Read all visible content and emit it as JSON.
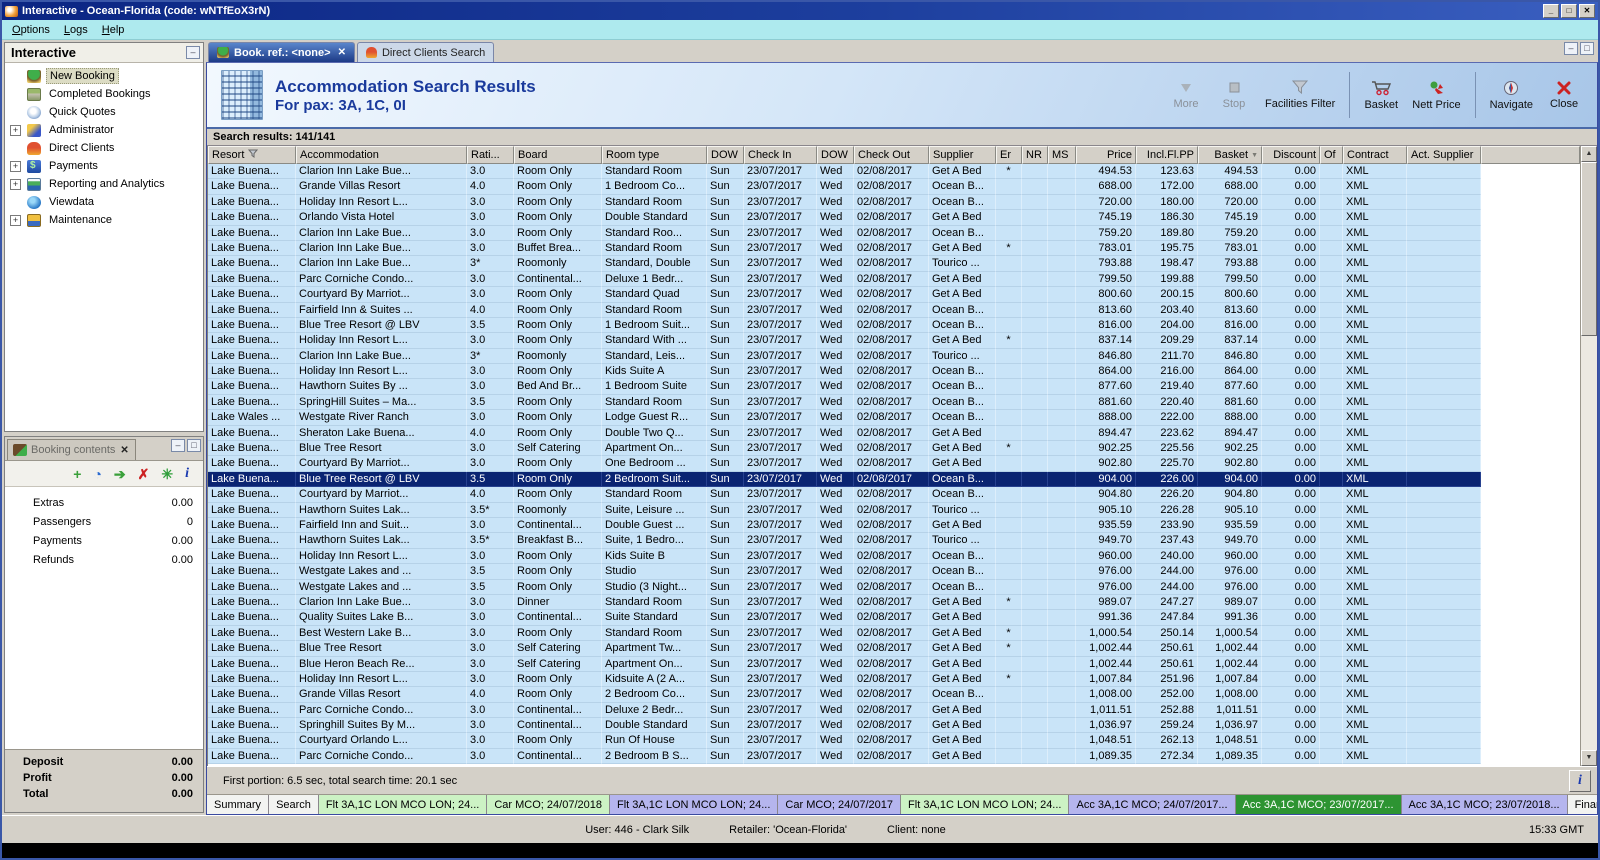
{
  "window": {
    "title": "Interactive - Ocean-Florida (code: wNTfEoX3rN)"
  },
  "menu": {
    "items": [
      "Options",
      "Logs",
      "Help"
    ]
  },
  "sidebar": {
    "title": "Interactive",
    "items": [
      {
        "label": "New Booking",
        "icon": "palm",
        "expandable": false,
        "selected": true
      },
      {
        "label": "Completed Bookings",
        "icon": "money",
        "expandable": false
      },
      {
        "label": "Quick Quotes",
        "icon": "clock",
        "expandable": false
      },
      {
        "label": "Administrator",
        "icon": "admin",
        "expandable": true
      },
      {
        "label": "Direct Clients",
        "icon": "person",
        "expandable": false
      },
      {
        "label": "Payments",
        "icon": "payments",
        "expandable": true
      },
      {
        "label": "Reporting and Analytics",
        "icon": "report",
        "expandable": true
      },
      {
        "label": "Viewdata",
        "icon": "globe",
        "expandable": false
      },
      {
        "label": "Maintenance",
        "icon": "toolbox",
        "expandable": true
      }
    ]
  },
  "booking_panel": {
    "title": "Booking contents",
    "toolbar_icons": [
      "add",
      "schedule",
      "basket-move",
      "delete",
      "holiday",
      "info"
    ],
    "items": [
      {
        "label": "Extras",
        "value": "0.00"
      },
      {
        "label": "Passengers",
        "value": "0"
      },
      {
        "label": "Payments",
        "value": "0.00"
      },
      {
        "label": "Refunds",
        "value": "0.00"
      }
    ],
    "totals": [
      {
        "label": "Deposit",
        "value": "0.00"
      },
      {
        "label": "Profit",
        "value": "0.00"
      },
      {
        "label": "Total",
        "value": "0.00"
      }
    ]
  },
  "doc_tabs": [
    {
      "label": "Book. ref.: <none>",
      "icon": "palm",
      "closable": true,
      "active": true
    },
    {
      "label": "Direct Clients Search",
      "icon": "person",
      "closable": false,
      "active": false
    }
  ],
  "header": {
    "title": "Accommodation Search Results",
    "subtitle": "For pax: 3A, 1C, 0I"
  },
  "toolbar": {
    "buttons": [
      {
        "label": "More",
        "icon": "more",
        "disabled": true
      },
      {
        "label": "Stop",
        "icon": "stop",
        "disabled": true
      },
      {
        "label": "Facilities Filter",
        "icon": "funnel",
        "disabled": false
      },
      {
        "sep": true
      },
      {
        "label": "Basket",
        "icon": "basket",
        "disabled": false
      },
      {
        "label": "Nett Price",
        "icon": "nett-price",
        "disabled": false
      },
      {
        "sep": true
      },
      {
        "label": "Navigate",
        "icon": "compass",
        "disabled": false
      },
      {
        "label": "Close",
        "icon": "close",
        "disabled": false
      }
    ]
  },
  "results": {
    "label": "Search results: 141/141"
  },
  "results_table": {
    "columns": [
      "Resort",
      "Accommodation",
      "Rati...",
      "Board",
      "Room type",
      "DOW",
      "Check In",
      "DOW",
      "Check Out",
      "Supplier",
      "Er",
      "NR",
      "MS",
      "Price",
      "Incl.Fl.PP",
      "Basket",
      "Discount",
      "Of",
      "Contract",
      "Act. Supplier"
    ],
    "row_defaults": {
      "dow_in": "Sun",
      "check_in": "23/07/2017",
      "dow_out": "Wed",
      "check_out": "02/08/2017",
      "discount": "0.00",
      "contract": "XML"
    },
    "selected_index": 20,
    "rows": [
      {
        "resort": "Lake Buena...",
        "accommodation": "Clarion Inn Lake Bue...",
        "rating": "3.0",
        "board": "Room Only",
        "room_type": "Standard Room",
        "supplier": "Get A Bed",
        "er": "*",
        "price": "494.53",
        "incl_fl_pp": "123.63",
        "basket": "494.53"
      },
      {
        "resort": "Lake Buena...",
        "accommodation": "Grande Villas Resort",
        "rating": "4.0",
        "board": "Room Only",
        "room_type": "1 Bedroom Co...",
        "supplier": "Ocean B...",
        "er": "",
        "price": "688.00",
        "incl_fl_pp": "172.00",
        "basket": "688.00"
      },
      {
        "resort": "Lake Buena...",
        "accommodation": "Holiday Inn Resort L...",
        "rating": "3.0",
        "board": "Room Only",
        "room_type": "Standard Room",
        "supplier": "Ocean B...",
        "er": "",
        "price": "720.00",
        "incl_fl_pp": "180.00",
        "basket": "720.00"
      },
      {
        "resort": "Lake Buena...",
        "accommodation": "Orlando Vista Hotel",
        "rating": "3.0",
        "board": "Room Only",
        "room_type": "Double Standard",
        "supplier": "Get A Bed",
        "er": "",
        "price": "745.19",
        "incl_fl_pp": "186.30",
        "basket": "745.19"
      },
      {
        "resort": "Lake Buena...",
        "accommodation": "Clarion Inn Lake Bue...",
        "rating": "3.0",
        "board": "Room Only",
        "room_type": "Standard Roo...",
        "supplier": "Ocean B...",
        "er": "",
        "price": "759.20",
        "incl_fl_pp": "189.80",
        "basket": "759.20"
      },
      {
        "resort": "Lake Buena...",
        "accommodation": "Clarion Inn Lake Bue...",
        "rating": "3.0",
        "board": "Buffet Brea...",
        "room_type": "Standard Room",
        "supplier": "Get A Bed",
        "er": "*",
        "price": "783.01",
        "incl_fl_pp": "195.75",
        "basket": "783.01"
      },
      {
        "resort": "Lake Buena...",
        "accommodation": "Clarion Inn Lake Bue...",
        "rating": "3*",
        "board": "Roomonly",
        "room_type": "Standard, Double",
        "supplier": "Tourico ...",
        "er": "",
        "price": "793.88",
        "incl_fl_pp": "198.47",
        "basket": "793.88"
      },
      {
        "resort": "Lake Buena...",
        "accommodation": "Parc Corniche Condo...",
        "rating": "3.0",
        "board": "Continental...",
        "room_type": "Deluxe 1 Bedr...",
        "supplier": "Get A Bed",
        "er": "",
        "price": "799.50",
        "incl_fl_pp": "199.88",
        "basket": "799.50"
      },
      {
        "resort": "Lake Buena...",
        "accommodation": "Courtyard By Marriot...",
        "rating": "3.0",
        "board": "Room Only",
        "room_type": "Standard Quad",
        "supplier": "Get A Bed",
        "er": "",
        "price": "800.60",
        "incl_fl_pp": "200.15",
        "basket": "800.60"
      },
      {
        "resort": "Lake Buena...",
        "accommodation": "Fairfield Inn & Suites ...",
        "rating": "4.0",
        "board": "Room Only",
        "room_type": "Standard Room",
        "supplier": "Ocean B...",
        "er": "",
        "price": "813.60",
        "incl_fl_pp": "203.40",
        "basket": "813.60"
      },
      {
        "resort": "Lake Buena...",
        "accommodation": "Blue Tree Resort @ LBV",
        "rating": "3.5",
        "board": "Room Only",
        "room_type": "1 Bedroom Suit...",
        "supplier": "Ocean B...",
        "er": "",
        "price": "816.00",
        "incl_fl_pp": "204.00",
        "basket": "816.00"
      },
      {
        "resort": "Lake Buena...",
        "accommodation": "Holiday Inn Resort L...",
        "rating": "3.0",
        "board": "Room Only",
        "room_type": "Standard With ...",
        "supplier": "Get A Bed",
        "er": "*",
        "price": "837.14",
        "incl_fl_pp": "209.29",
        "basket": "837.14"
      },
      {
        "resort": "Lake Buena...",
        "accommodation": "Clarion Inn Lake Bue...",
        "rating": "3*",
        "board": "Roomonly",
        "room_type": "Standard, Leis...",
        "supplier": "Tourico ...",
        "er": "",
        "price": "846.80",
        "incl_fl_pp": "211.70",
        "basket": "846.80"
      },
      {
        "resort": "Lake Buena...",
        "accommodation": "Holiday Inn Resort L...",
        "rating": "3.0",
        "board": "Room Only",
        "room_type": "Kids Suite A",
        "supplier": "Ocean B...",
        "er": "",
        "price": "864.00",
        "incl_fl_pp": "216.00",
        "basket": "864.00"
      },
      {
        "resort": "Lake Buena...",
        "accommodation": "Hawthorn Suites By ...",
        "rating": "3.0",
        "board": "Bed And Br...",
        "room_type": "1 Bedroom Suite",
        "supplier": "Ocean B...",
        "er": "",
        "price": "877.60",
        "incl_fl_pp": "219.40",
        "basket": "877.60"
      },
      {
        "resort": "Lake Buena...",
        "accommodation": "SpringHill Suites – Ma...",
        "rating": "3.5",
        "board": "Room Only",
        "room_type": "Standard Room",
        "supplier": "Ocean B...",
        "er": "",
        "price": "881.60",
        "incl_fl_pp": "220.40",
        "basket": "881.60"
      },
      {
        "resort": "Lake Wales ...",
        "accommodation": "Westgate River Ranch",
        "rating": "3.0",
        "board": "Room Only",
        "room_type": "Lodge Guest R...",
        "supplier": "Ocean B...",
        "er": "",
        "price": "888.00",
        "incl_fl_pp": "222.00",
        "basket": "888.00"
      },
      {
        "resort": "Lake Buena...",
        "accommodation": "Sheraton Lake Buena...",
        "rating": "4.0",
        "board": "Room Only",
        "room_type": "Double Two Q...",
        "supplier": "Get A Bed",
        "er": "",
        "price": "894.47",
        "incl_fl_pp": "223.62",
        "basket": "894.47"
      },
      {
        "resort": "Lake Buena...",
        "accommodation": "Blue Tree Resort",
        "rating": "3.0",
        "board": "Self Catering",
        "room_type": "Apartment On...",
        "supplier": "Get A Bed",
        "er": "*",
        "price": "902.25",
        "incl_fl_pp": "225.56",
        "basket": "902.25"
      },
      {
        "resort": "Lake Buena...",
        "accommodation": "Courtyard By Marriot...",
        "rating": "3.0",
        "board": "Room Only",
        "room_type": "One Bedroom ...",
        "supplier": "Get A Bed",
        "er": "",
        "price": "902.80",
        "incl_fl_pp": "225.70",
        "basket": "902.80"
      },
      {
        "resort": "Lake Buena...",
        "accommodation": "Blue Tree Resort @ LBV",
        "rating": "3.5",
        "board": "Room Only",
        "room_type": "2 Bedroom Suit...",
        "supplier": "Ocean B...",
        "er": "",
        "price": "904.00",
        "incl_fl_pp": "226.00",
        "basket": "904.00"
      },
      {
        "resort": "Lake Buena...",
        "accommodation": "Courtyard by Marriot...",
        "rating": "4.0",
        "board": "Room Only",
        "room_type": "Standard Room",
        "supplier": "Ocean B...",
        "er": "",
        "price": "904.80",
        "incl_fl_pp": "226.20",
        "basket": "904.80"
      },
      {
        "resort": "Lake Buena...",
        "accommodation": "Hawthorn Suites Lak...",
        "rating": "3.5*",
        "board": "Roomonly",
        "room_type": "Suite, Leisure ...",
        "supplier": "Tourico ...",
        "er": "",
        "price": "905.10",
        "incl_fl_pp": "226.28",
        "basket": "905.10"
      },
      {
        "resort": "Lake Buena...",
        "accommodation": "Fairfield Inn and Suit...",
        "rating": "3.0",
        "board": "Continental...",
        "room_type": "Double Guest ...",
        "supplier": "Get A Bed",
        "er": "",
        "price": "935.59",
        "incl_fl_pp": "233.90",
        "basket": "935.59"
      },
      {
        "resort": "Lake Buena...",
        "accommodation": "Hawthorn Suites Lak...",
        "rating": "3.5*",
        "board": "Breakfast B...",
        "room_type": "Suite, 1 Bedro...",
        "supplier": "Tourico ...",
        "er": "",
        "price": "949.70",
        "incl_fl_pp": "237.43",
        "basket": "949.70"
      },
      {
        "resort": "Lake Buena...",
        "accommodation": "Holiday Inn Resort L...",
        "rating": "3.0",
        "board": "Room Only",
        "room_type": "Kids Suite B",
        "supplier": "Ocean B...",
        "er": "",
        "price": "960.00",
        "incl_fl_pp": "240.00",
        "basket": "960.00"
      },
      {
        "resort": "Lake Buena...",
        "accommodation": "Westgate Lakes and ...",
        "rating": "3.5",
        "board": "Room Only",
        "room_type": "Studio",
        "supplier": "Ocean B...",
        "er": "",
        "price": "976.00",
        "incl_fl_pp": "244.00",
        "basket": "976.00"
      },
      {
        "resort": "Lake Buena...",
        "accommodation": "Westgate Lakes and ...",
        "rating": "3.5",
        "board": "Room Only",
        "room_type": "Studio (3 Night...",
        "supplier": "Ocean B...",
        "er": "",
        "price": "976.00",
        "incl_fl_pp": "244.00",
        "basket": "976.00"
      },
      {
        "resort": "Lake Buena...",
        "accommodation": "Clarion Inn Lake Bue...",
        "rating": "3.0",
        "board": "Dinner",
        "room_type": "Standard Room",
        "supplier": "Get A Bed",
        "er": "*",
        "price": "989.07",
        "incl_fl_pp": "247.27",
        "basket": "989.07"
      },
      {
        "resort": "Lake Buena...",
        "accommodation": "Quality Suites Lake B...",
        "rating": "3.0",
        "board": "Continental...",
        "room_type": "Suite Standard",
        "supplier": "Get A Bed",
        "er": "",
        "price": "991.36",
        "incl_fl_pp": "247.84",
        "basket": "991.36"
      },
      {
        "resort": "Lake Buena...",
        "accommodation": "Best Western Lake B...",
        "rating": "3.0",
        "board": "Room Only",
        "room_type": "Standard Room",
        "supplier": "Get A Bed",
        "er": "*",
        "price": "1,000.54",
        "incl_fl_pp": "250.14",
        "basket": "1,000.54"
      },
      {
        "resort": "Lake Buena...",
        "accommodation": "Blue Tree Resort",
        "rating": "3.0",
        "board": "Self Catering",
        "room_type": "Apartment Tw...",
        "supplier": "Get A Bed",
        "er": "*",
        "price": "1,002.44",
        "incl_fl_pp": "250.61",
        "basket": "1,002.44"
      },
      {
        "resort": "Lake Buena...",
        "accommodation": "Blue Heron Beach Re...",
        "rating": "3.0",
        "board": "Self Catering",
        "room_type": "Apartment On...",
        "supplier": "Get A Bed",
        "er": "",
        "price": "1,002.44",
        "incl_fl_pp": "250.61",
        "basket": "1,002.44"
      },
      {
        "resort": "Lake Buena...",
        "accommodation": "Holiday Inn Resort L...",
        "rating": "3.0",
        "board": "Room Only",
        "room_type": "Kidsuite A (2 A...",
        "supplier": "Get A Bed",
        "er": "*",
        "price": "1,007.84",
        "incl_fl_pp": "251.96",
        "basket": "1,007.84"
      },
      {
        "resort": "Lake Buena...",
        "accommodation": "Grande Villas Resort",
        "rating": "4.0",
        "board": "Room Only",
        "room_type": "2 Bedroom Co...",
        "supplier": "Ocean B...",
        "er": "",
        "price": "1,008.00",
        "incl_fl_pp": "252.00",
        "basket": "1,008.00"
      },
      {
        "resort": "Lake Buena...",
        "accommodation": "Parc Corniche Condo...",
        "rating": "3.0",
        "board": "Continental...",
        "room_type": "Deluxe 2 Bedr...",
        "supplier": "Get A Bed",
        "er": "",
        "price": "1,011.51",
        "incl_fl_pp": "252.88",
        "basket": "1,011.51"
      },
      {
        "resort": "Lake Buena...",
        "accommodation": "Springhill Suites By M...",
        "rating": "3.0",
        "board": "Continental...",
        "room_type": "Double Standard",
        "supplier": "Get A Bed",
        "er": "",
        "price": "1,036.97",
        "incl_fl_pp": "259.24",
        "basket": "1,036.97"
      },
      {
        "resort": "Lake Buena...",
        "accommodation": "Courtyard Orlando L...",
        "rating": "3.0",
        "board": "Room Only",
        "room_type": "Run  Of House",
        "supplier": "Get A Bed",
        "er": "",
        "price": "1,048.51",
        "incl_fl_pp": "262.13",
        "basket": "1,048.51"
      },
      {
        "resort": "Lake Buena...",
        "accommodation": "Parc Corniche Condo...",
        "rating": "3.0",
        "board": "Continental...",
        "room_type": "2 Bedroom B S...",
        "supplier": "Get A Bed",
        "er": "",
        "price": "1,089.35",
        "incl_fl_pp": "272.34",
        "basket": "1,089.35"
      }
    ]
  },
  "status_line": "First portion: 6.5 sec, total search time: 20.1 sec",
  "bottom_tabs": [
    {
      "label": "Summary",
      "color": "plain"
    },
    {
      "label": "Search",
      "color": "plain"
    },
    {
      "label": "Flt 3A,1C LON MCO LON; 24...",
      "color": "green"
    },
    {
      "label": "Car MCO; 24/07/2018",
      "color": "green"
    },
    {
      "label": "Flt 3A,1C LON MCO LON; 24...",
      "color": "purple"
    },
    {
      "label": "Car MCO; 24/07/2017",
      "color": "purple"
    },
    {
      "label": "Flt 3A,1C LON MCO LON; 24...",
      "color": "green"
    },
    {
      "label": "Acc 3A,1C MCO; 24/07/2017...",
      "color": "purple"
    },
    {
      "label": "Acc 3A,1C MCO; 23/07/2017...",
      "color": "selected"
    },
    {
      "label": "Acc 3A,1C MCO; 23/07/2018...",
      "color": "purple"
    },
    {
      "label": "Financial Summary",
      "color": "plain"
    }
  ],
  "statusbar": {
    "user": "User: 446 - Clark Silk",
    "retailer": "Retailer: 'Ocean-Florida'",
    "client": "Client: none",
    "time": "15:33 GMT"
  },
  "colors": {
    "row_blue": "#c9e4f8",
    "selected_row": "#0a2472",
    "banner_title": "#1a3a9c",
    "tab_green": "#ccf2c4",
    "tab_purple": "#b5b5ee",
    "tab_selected_green": "#2d9432"
  }
}
